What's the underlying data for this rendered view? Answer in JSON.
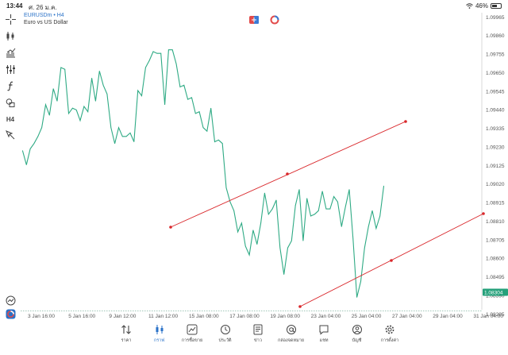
{
  "status_bar": {
    "time": "13:44",
    "date": "ศ. 26 ม.ค.",
    "battery": "46%",
    "battery_level": 0.46
  },
  "chart_header": {
    "symbol": "EURUSDm",
    "timeframe": "H4",
    "description": "Euro vs US Dollar"
  },
  "left_toolbar": [
    {
      "icon": "crosshair-icon"
    },
    {
      "icon": "candlestick-type-icon"
    },
    {
      "icon": "indicators-icon"
    },
    {
      "icon": "objects-list-icon"
    },
    {
      "icon": "function-icon"
    },
    {
      "icon": "shapes-icon"
    },
    {
      "icon": "timeframe-icon",
      "text": "H4"
    },
    {
      "icon": "arrow-cursor-icon"
    }
  ],
  "chart_data": {
    "type": "line",
    "title": "",
    "xlabel": "",
    "ylabel": "",
    "ylim": [
      1.0831,
      1.0999
    ],
    "y_ticks": [
      "1.09965",
      "1.09860",
      "1.09755",
      "1.09650",
      "1.09545",
      "1.09440",
      "1.09335",
      "1.09230",
      "1.09125",
      "1.09020",
      "1.08915",
      "1.08810",
      "1.08705",
      "1.08600",
      "1.08495",
      "1.08390",
      "1.08285"
    ],
    "x_ticks": [
      "3 Jan 16:00",
      "5 Jan 16:00",
      "9 Jan 12:00",
      "11 Jan 12:00",
      "15 Jan 08:00",
      "17 Jan 08:00",
      "19 Jan 08:00",
      "23 Jan 04:00",
      "25 Jan 04:00",
      "27 Jan 04:00",
      "29 Jan 04:00",
      "31 Jan 04:00"
    ],
    "x": [
      1,
      3,
      5,
      7,
      9,
      11,
      13,
      15,
      17,
      19,
      21,
      23,
      25,
      27,
      29,
      31,
      33,
      35,
      37,
      39,
      41,
      43,
      45,
      47,
      49,
      51,
      53,
      55,
      57,
      59,
      61,
      63,
      65,
      67,
      69,
      71,
      73,
      75,
      77,
      79,
      81,
      83,
      85,
      87,
      89,
      91,
      93,
      95,
      97,
      99,
      101,
      103,
      105,
      107,
      109,
      111,
      113,
      115,
      117,
      119,
      121,
      123,
      125,
      127,
      129,
      131,
      133,
      135,
      137,
      139,
      141,
      143,
      145,
      147,
      149,
      151,
      153,
      155,
      157,
      159,
      161,
      163,
      165,
      167,
      169,
      171,
      173,
      175,
      177,
      179,
      181,
      183,
      185,
      187,
      189
    ],
    "values": [
      1.0921,
      1.0913,
      1.0922,
      1.0925,
      1.0929,
      1.0934,
      1.0947,
      1.0941,
      1.0956,
      1.0949,
      1.0968,
      1.0967,
      1.0942,
      1.0945,
      1.0944,
      1.0938,
      1.0946,
      1.0943,
      1.0962,
      1.0949,
      1.0966,
      1.0958,
      1.0953,
      1.0934,
      1.0925,
      1.0934,
      1.0929,
      1.0929,
      1.0931,
      1.0926,
      1.0955,
      1.0952,
      1.0968,
      1.0972,
      1.0977,
      1.0976,
      1.0976,
      1.0947,
      1.0978,
      1.0978,
      1.097,
      1.0957,
      1.0958,
      1.095,
      1.0951,
      1.0942,
      1.0943,
      1.0934,
      1.0932,
      1.0945,
      1.0926,
      1.0927,
      1.0925,
      1.09,
      1.0892,
      1.0887,
      1.0875,
      1.088,
      1.0867,
      1.0862,
      1.0876,
      1.0868,
      1.088,
      1.0897,
      1.0885,
      1.0888,
      1.0893,
      1.0866,
      1.0851,
      1.0866,
      1.087,
      1.089,
      1.0899,
      1.087,
      1.0894,
      1.0884,
      1.0885,
      1.0887,
      1.0898,
      1.0888,
      1.0888,
      1.0895,
      1.0892,
      1.0878,
      1.0889,
      1.0899,
      1.0871,
      1.0838,
      1.0847,
      1.0866,
      1.0878,
      1.0887,
      1.0877,
      1.0884,
      1.0901,
      1.0898
    ],
    "current_price": "1.08304",
    "colors": {
      "line": "#2eaa84",
      "trendline": "#d9262a",
      "price_tag": "#26a17b",
      "bid_line": "#6aa88f"
    }
  },
  "top_icons": [
    "one-click-trading-icon",
    "chart-switch-icon"
  ],
  "bottom_nav": [
    {
      "icon": "quotes-icon",
      "label": "ราคา"
    },
    {
      "icon": "chart-icon",
      "label": "กราฟ",
      "active": true
    },
    {
      "icon": "trade-icon",
      "label": "การซื้อขาย"
    },
    {
      "icon": "history-icon",
      "label": "ประวัติ"
    },
    {
      "icon": "news-icon",
      "label": "ข่าว"
    },
    {
      "icon": "mailbox-icon",
      "label": "กล่องจดหมาย"
    },
    {
      "icon": "chat-icon",
      "label": "แชท"
    },
    {
      "icon": "account-icon",
      "label": "บัญชี"
    },
    {
      "icon": "settings-icon",
      "label": "การตั้งค่า"
    }
  ]
}
